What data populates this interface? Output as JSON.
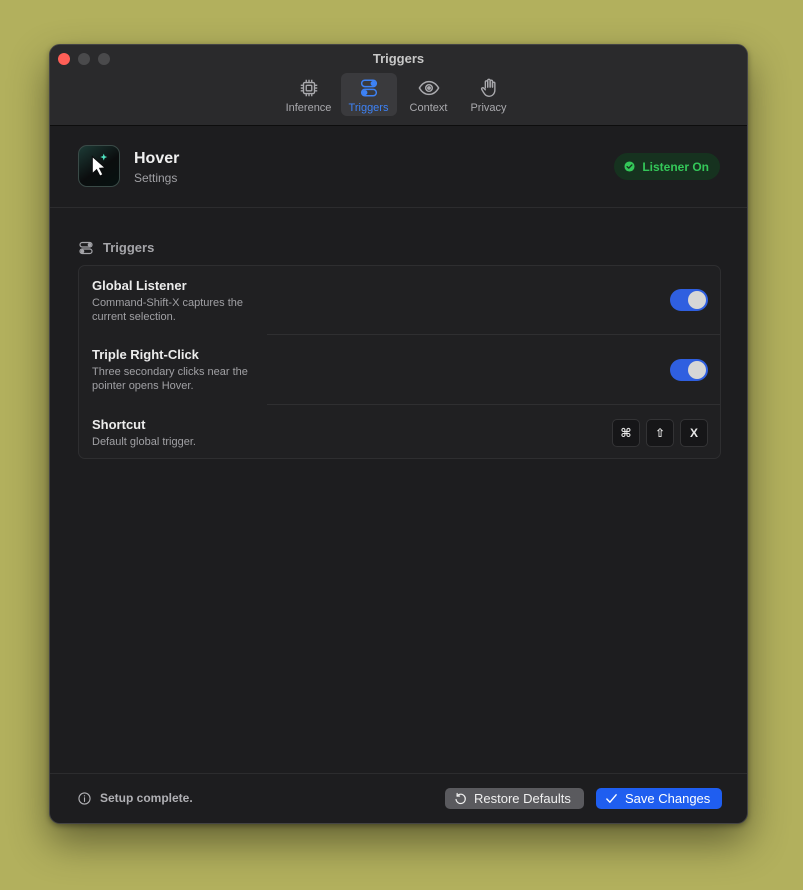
{
  "window": {
    "title": "Triggers"
  },
  "toolbar": {
    "tabs": [
      {
        "label": "Inference",
        "icon": "cpu-chip-icon",
        "active": false
      },
      {
        "label": "Triggers",
        "icon": "toggles-icon",
        "active": true
      },
      {
        "label": "Context",
        "icon": "eye-icon",
        "active": false
      },
      {
        "label": "Privacy",
        "icon": "hand-icon",
        "active": false
      }
    ]
  },
  "header": {
    "app_name": "Hover",
    "subtitle": "Settings",
    "app_icon": "pointer-sparkle-icon",
    "status_label": "Listener On",
    "status_color": "#34c759"
  },
  "section": {
    "title": "Triggers",
    "icon": "toggles-icon"
  },
  "rows": [
    {
      "title": "Global Listener",
      "description": "Command-Shift-X captures the current selection.",
      "toggle_on": true
    },
    {
      "title": "Triple Right-Click",
      "description": "Three secondary clicks near the pointer opens Hover.",
      "toggle_on": true
    },
    {
      "title": "Shortcut",
      "description": "Default global trigger.",
      "keys": [
        "⌘",
        "⇧",
        "X"
      ]
    }
  ],
  "footer": {
    "status_text": "Setup complete.",
    "restore_label": "Restore Defaults",
    "save_label": "Save Changes"
  },
  "colors": {
    "accent": "#1f5ef0",
    "toggle_on": "#2f5fe0",
    "close": "#ff5f57"
  }
}
